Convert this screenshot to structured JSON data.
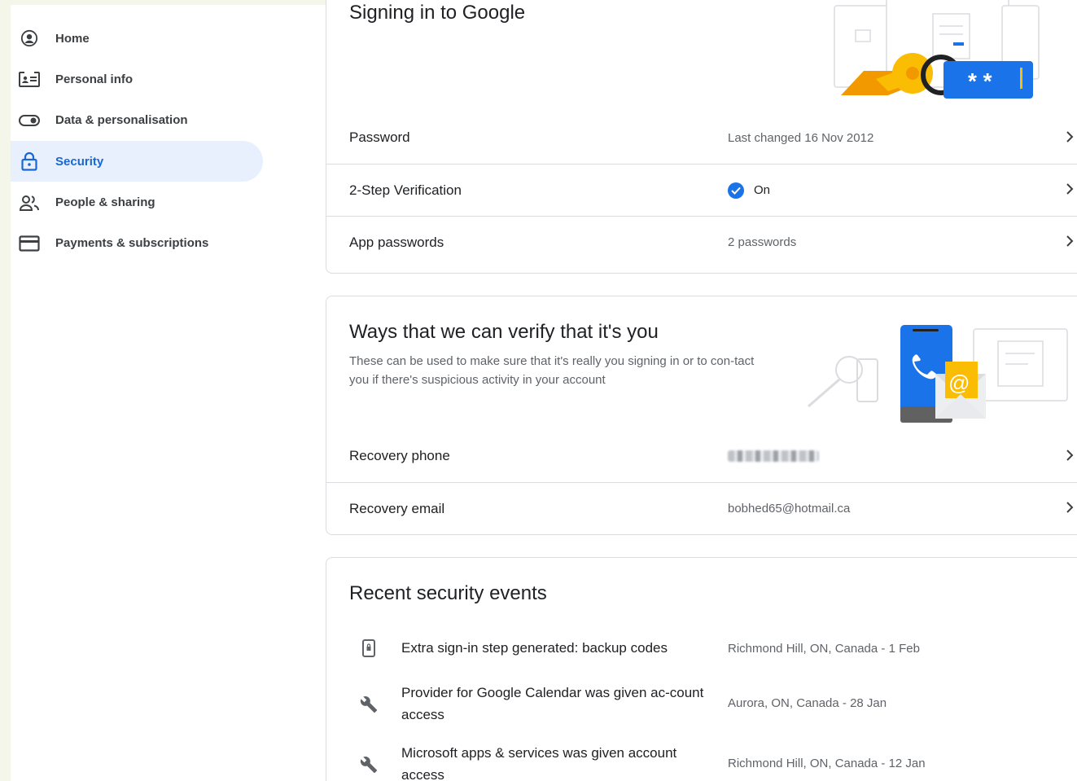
{
  "colors": {
    "accent": "#1a73e8",
    "active_bg": "#e8f0fe",
    "active_text": "#1967d2",
    "border": "#dadce0"
  },
  "sidebar": {
    "items": [
      {
        "label": "Home",
        "icon": "account-circle-icon"
      },
      {
        "label": "Personal info",
        "icon": "id-card-icon"
      },
      {
        "label": "Data & personalisation",
        "icon": "toggle-icon"
      },
      {
        "label": "Security",
        "icon": "lock-icon",
        "active": true
      },
      {
        "label": "People & sharing",
        "icon": "people-icon"
      },
      {
        "label": "Payments & subscriptions",
        "icon": "credit-card-icon"
      }
    ]
  },
  "signing_in": {
    "title": "Signing in to Google",
    "rows": [
      {
        "label": "Password",
        "value": "Last changed 16 Nov 2012"
      },
      {
        "label": "2-Step Verification",
        "value": "On"
      },
      {
        "label": "App passwords",
        "value": "2 passwords"
      }
    ]
  },
  "verify": {
    "title": "Ways that we can verify that it's you",
    "description": "These can be used to make sure that it's really you signing in or to con-tact you if there's suspicious activity in your account",
    "rows": [
      {
        "label": "Recovery phone",
        "value": ""
      },
      {
        "label": "Recovery email",
        "value": "bobhed65@hotmail.ca"
      }
    ]
  },
  "events": {
    "title": "Recent security events",
    "items": [
      {
        "text": "Extra sign-in step generated: backup codes",
        "location": "Richmond Hill, ON, Canada - 1 Feb",
        "icon": "phone-lock-icon"
      },
      {
        "text": "Provider for Google Calendar was given ac-count access",
        "location": "Aurora, ON, Canada - 28 Jan",
        "icon": "wrench-icon"
      },
      {
        "text": "Microsoft apps & services was given account access",
        "location": "Richmond Hill, ON, Canada - 12 Jan",
        "icon": "wrench-icon"
      }
    ]
  }
}
